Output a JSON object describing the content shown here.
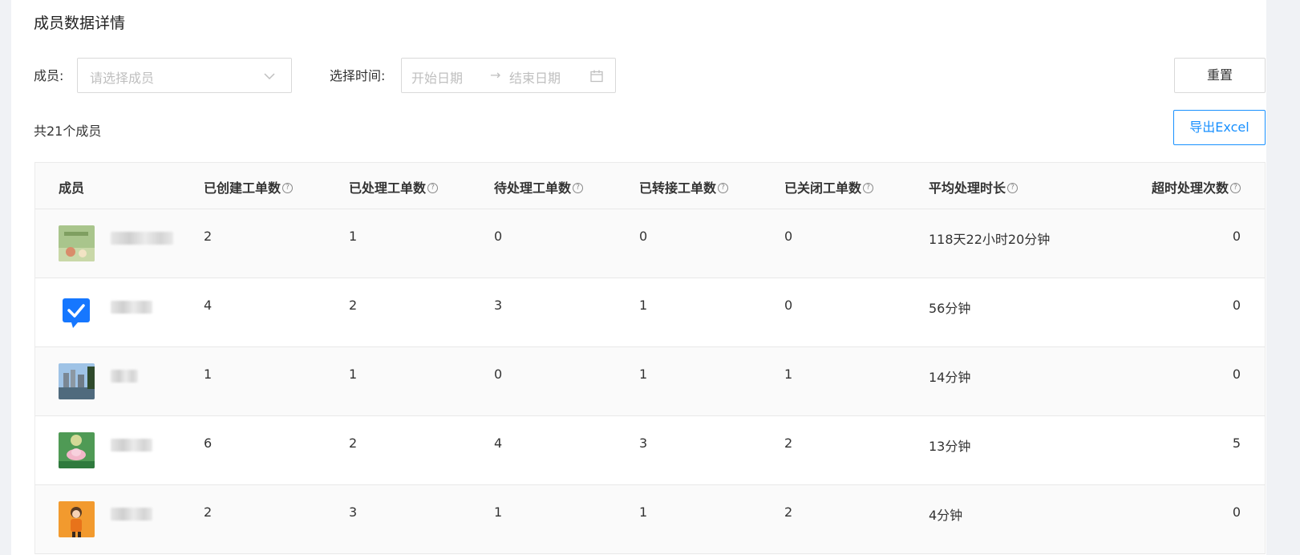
{
  "page_title": "成员数据详情",
  "filters": {
    "member_label": "成员:",
    "member_placeholder": "请选择成员",
    "time_label": "选择时间:",
    "start_placeholder": "开始日期",
    "range_arrow": "→",
    "end_placeholder": "结束日期"
  },
  "buttons": {
    "reset": "重置",
    "export": "导出Excel"
  },
  "member_count": "共21个成员",
  "table": {
    "columns": [
      "成员",
      "已创建工单数",
      "已处理工单数",
      "待处理工单数",
      "已转接工单数",
      "已关闭工单数",
      "平均处理时长",
      "超时处理次数"
    ],
    "help_glyph": "?",
    "rows": [
      {
        "avatar": "avatar-greeting-card",
        "name_fragment": "",
        "created": "2",
        "handled": "1",
        "pending": "0",
        "transferred": "0",
        "closed": "0",
        "avg_time": "118天22小时20分钟",
        "timeouts": "0"
      },
      {
        "avatar": "avatar-checkmark-chat",
        "name_fragment": "",
        "created": "4",
        "handled": "2",
        "pending": "3",
        "transferred": "1",
        "closed": "0",
        "avg_time": "56分钟",
        "timeouts": "0"
      },
      {
        "avatar": "avatar-city-lake",
        "name_fragment": "",
        "created": "1",
        "handled": "1",
        "pending": "0",
        "transferred": "1",
        "closed": "1",
        "avg_time": "14分钟",
        "timeouts": "0"
      },
      {
        "avatar": "avatar-lotus-flower",
        "name_fragment": "",
        "created": "6",
        "handled": "2",
        "pending": "4",
        "transferred": "3",
        "closed": "2",
        "avg_time": "13分钟",
        "timeouts": "5"
      },
      {
        "avatar": "avatar-cartoon-person",
        "name_fragment": "",
        "created": "2",
        "handled": "3",
        "pending": "1",
        "transferred": "1",
        "closed": "2",
        "avg_time": "4分钟",
        "timeouts": "0"
      }
    ]
  },
  "colors": {
    "primary": "#1890ff",
    "border": "#d9d9d9",
    "header_bg": "#fafafa"
  }
}
